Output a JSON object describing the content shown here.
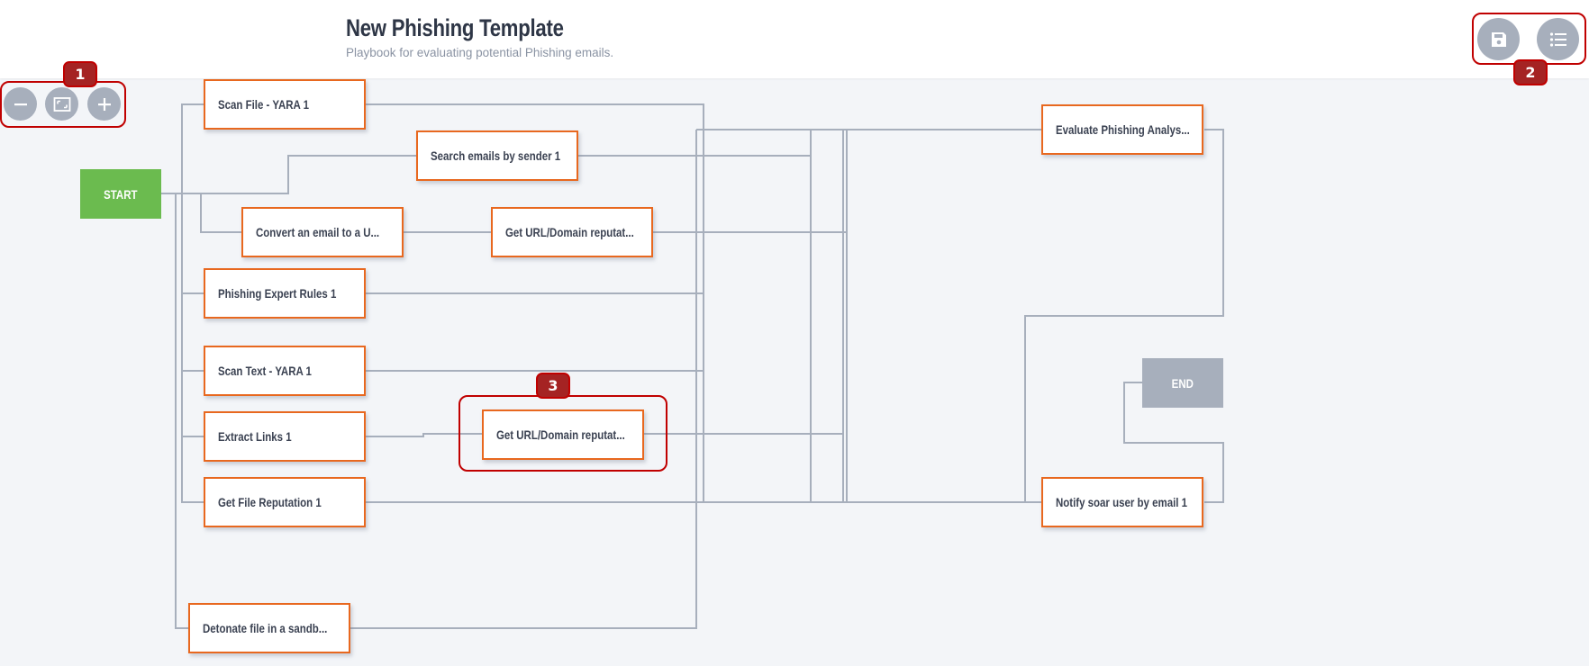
{
  "header": {
    "title": "New Phishing Template",
    "subtitle": "Playbook for evaluating potential Phishing emails."
  },
  "toolbar_left": {
    "zoom_out": "zoom-out",
    "fit": "fit-to-screen",
    "zoom_in": "zoom-in"
  },
  "toolbar_right": {
    "save": "save",
    "list": "list"
  },
  "annotations": [
    "1",
    "2",
    "3"
  ],
  "colors": {
    "node_border": "#e8681f",
    "start": "#6bbb4f",
    "end": "#a7afbc",
    "edge": "#a7afbc",
    "annotation": "#c00000"
  },
  "nodes": {
    "start": "START",
    "end": "END",
    "scan_file_yara": "Scan File - YARA 1",
    "search_emails": "Search emails by sender 1",
    "convert_email": "Convert an email to a U...",
    "url_rep_1": "Get URL/Domain reputat...",
    "phishing_rules": "Phishing Expert Rules 1",
    "scan_text_yara": "Scan Text - YARA 1",
    "extract_links": "Extract Links 1",
    "url_rep_2": "Get URL/Domain reputat...",
    "file_rep": "Get File Reputation 1",
    "detonate": "Detonate file in a sandb...",
    "evaluate": "Evaluate Phishing Analys...",
    "notify": "Notify soar user by email 1"
  }
}
